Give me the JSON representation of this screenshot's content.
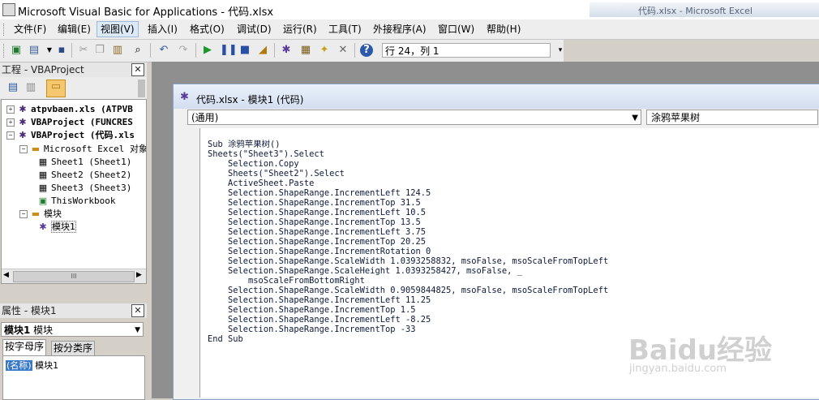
{
  "window": {
    "title": "Microsoft Visual Basic for Applications - 代码.xlsx",
    "background_title": "代码.xlsx - Microsoft Excel"
  },
  "menu": [
    "文件(F)",
    "编辑(E)",
    "视图(V)",
    "插入(I)",
    "格式(O)",
    "调试(D)",
    "运行(R)",
    "工具(T)",
    "外接程序(A)",
    "窗口(W)",
    "帮助(H)"
  ],
  "toolbar": {
    "position": "行 24，列 1"
  },
  "project_pane": {
    "title": "工程 - VBAProject",
    "close": "✕",
    "tree": [
      {
        "label": "atpvbaen.xls (ATPVB",
        "bold": true
      },
      {
        "label": "VBAProject (FUNCRES",
        "bold": true
      },
      {
        "label": "VBAProject (代码.xls",
        "bold": true
      },
      {
        "label": "Microsoft Excel 对象"
      },
      {
        "label": "Sheet1 (Sheet1)"
      },
      {
        "label": "Sheet2 (Sheet2)"
      },
      {
        "label": "Sheet3 (Sheet3)"
      },
      {
        "label": "ThisWorkbook"
      },
      {
        "label": "模块"
      },
      {
        "label": "模块1"
      }
    ],
    "hscroll_grip": "III"
  },
  "properties_pane": {
    "title": "属性 - 模块1",
    "close": "✕",
    "object_bold": "模块1",
    "object_type": " 模块",
    "tabs": [
      "按字母序",
      "按分类序"
    ],
    "rows": [
      {
        "key": "(名称)",
        "value": "模块1"
      }
    ]
  },
  "code_window": {
    "title": "代码.xlsx - 模块1 (代码)",
    "object_combo": "(通用)",
    "proc_combo": "涂鸦苹果树",
    "lines": [
      "Sub 涂鸦苹果树()",
      "Sheets(\"Sheet3\").Select",
      "    Selection.Copy",
      "    Sheets(\"Sheet2\").Select",
      "    ActiveSheet.Paste",
      "    Selection.ShapeRange.IncrementLeft 124.5",
      "    Selection.ShapeRange.IncrementTop 31.5",
      "    Selection.ShapeRange.IncrementLeft 10.5",
      "    Selection.ShapeRange.IncrementTop 13.5",
      "    Selection.ShapeRange.IncrementLeft 3.75",
      "    Selection.ShapeRange.IncrementTop 20.25",
      "    Selection.ShapeRange.IncrementRotation 0",
      "    Selection.ShapeRange.ScaleWidth 1.0393258832, msoFalse, msoScaleFromTopLeft",
      "    Selection.ShapeRange.ScaleHeight 1.0393258427, msoFalse, _",
      "        msoScaleFromBottomRight",
      "    Selection.ShapeRange.ScaleWidth 0.9059844825, msoFalse, msoScaleFromTopLeft",
      "    Selection.ShapeRange.IncrementLeft 11.25",
      "    Selection.ShapeRange.IncrementTop 1.5",
      "    Selection.ShapeRange.IncrementLeft -8.25",
      "    Selection.ShapeRange.IncrementTop -33",
      "End Sub"
    ]
  },
  "watermark": {
    "main": "Baidu经验",
    "sub": "jingyan.baidu.com"
  }
}
